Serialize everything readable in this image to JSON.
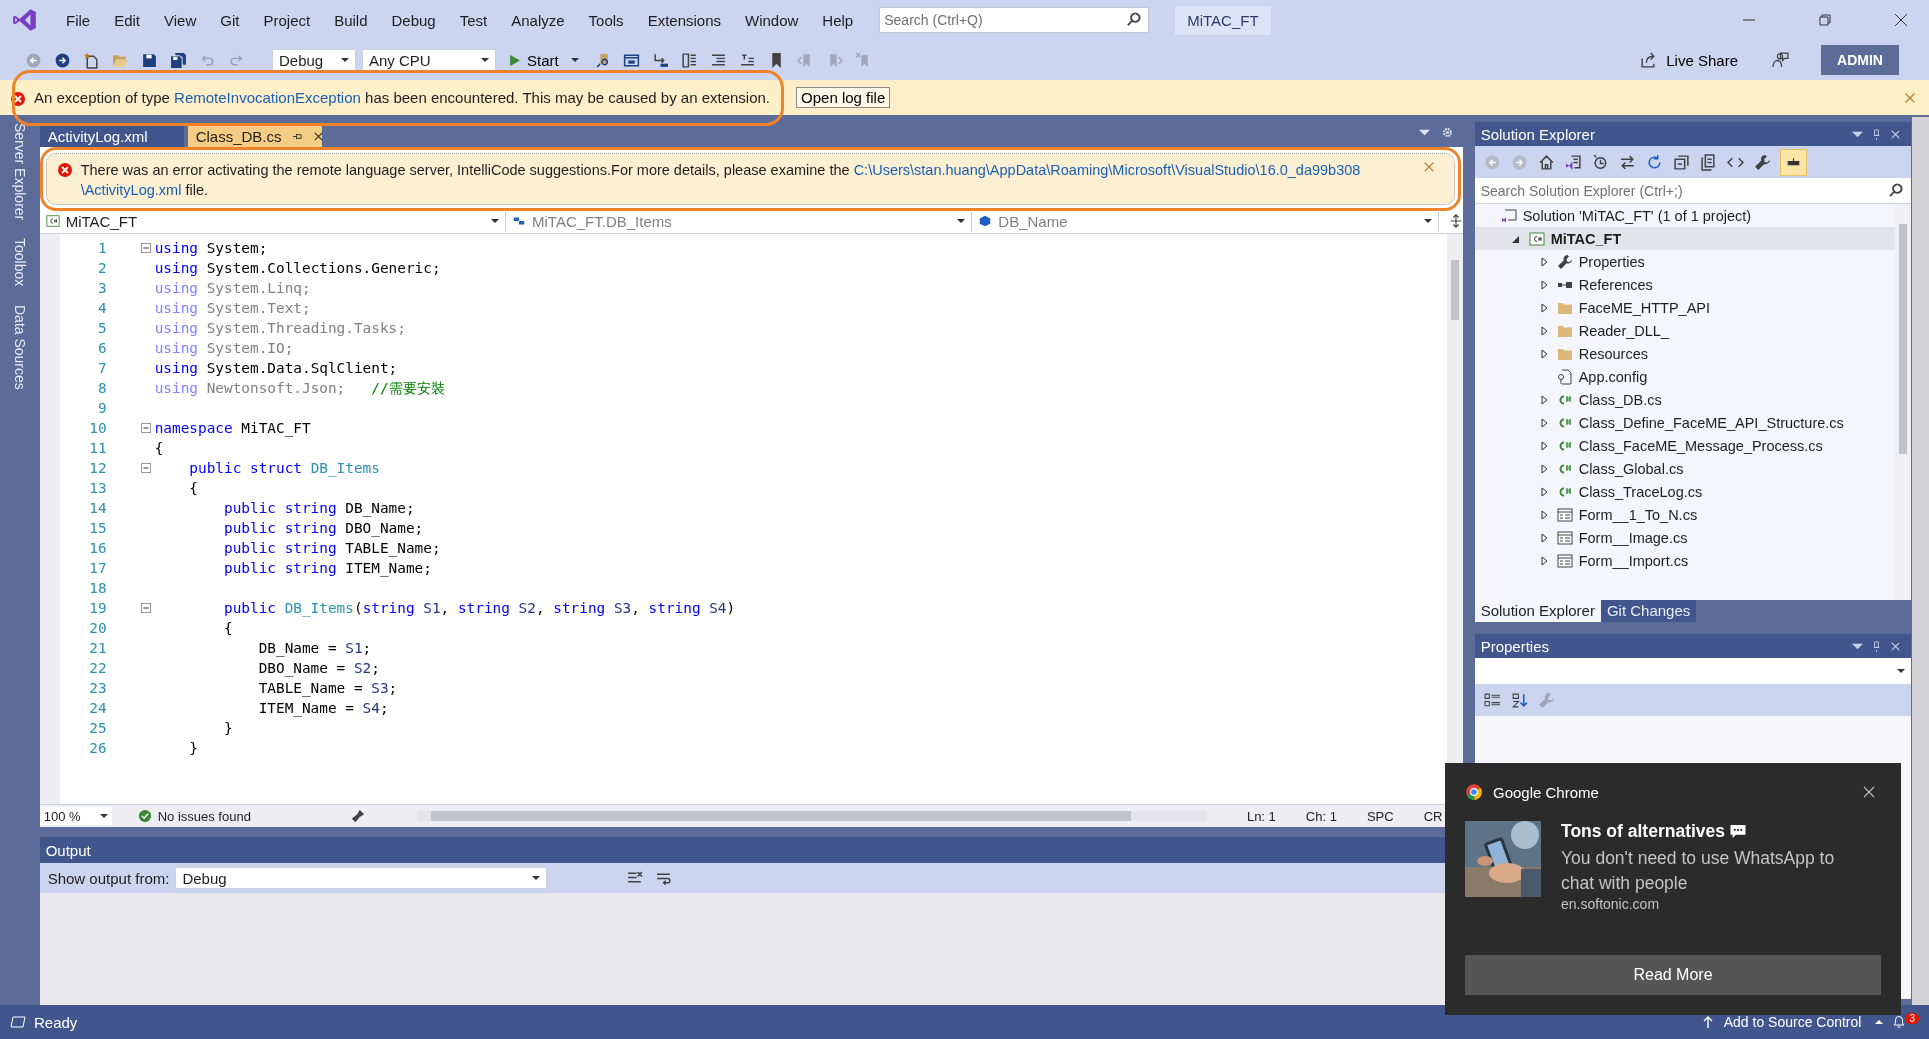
{
  "menu": [
    "File",
    "Edit",
    "View",
    "Git",
    "Project",
    "Build",
    "Debug",
    "Test",
    "Analyze",
    "Tools",
    "Extensions",
    "Window",
    "Help"
  ],
  "search": {
    "placeholder": "Search (Ctrl+Q)"
  },
  "solution_name": "MiTAC_FT",
  "toolbar": {
    "configuration": "Debug",
    "platform": "Any CPU",
    "start": "Start",
    "live_share": "Live Share",
    "account": "ADMIN"
  },
  "info_bar": {
    "before": "An exception of type ",
    "link": "RemoteInvocationException",
    "after": " has been encountered. This may be caused by an extension.",
    "button": "Open log file"
  },
  "side_tabs": [
    "Server Explorer",
    "Toolbox",
    "Data Sources"
  ],
  "editor": {
    "tabs": [
      {
        "label": "ActivityLog.xml",
        "selected": false
      },
      {
        "label": "Class_DB.cs",
        "selected": true
      }
    ],
    "error_bar": {
      "before": "There was an error activating the remote language server, IntelliCode suggestions.For more details, please examine the ",
      "link_lines": [
        "C:\\Users\\stan.huang\\AppData\\Roaming\\Microsoft\\VisualStudio\\16.0_da99b308",
        "\\ActivityLog.xml"
      ],
      "after": " file."
    },
    "nav": [
      "MiTAC_FT",
      "MiTAC_FT.DB_Items",
      "DB_Name"
    ],
    "lines": [
      {
        "number": "1",
        "foldable": true,
        "tokens": [
          {
            "kind": "kw",
            "text": "using"
          },
          {
            "kind": "plain",
            "text": " System;"
          }
        ]
      },
      {
        "number": "2",
        "foldable": false,
        "tokens": [
          {
            "kind": "kw",
            "text": "using"
          },
          {
            "kind": "plain",
            "text": " System.Collections.Generic;"
          }
        ]
      },
      {
        "number": "3",
        "foldable": false,
        "tokens": [
          {
            "kind": "kwdim",
            "text": "using"
          },
          {
            "kind": "dim",
            "text": " System.Linq;"
          }
        ]
      },
      {
        "number": "4",
        "foldable": false,
        "tokens": [
          {
            "kind": "kwdim",
            "text": "using"
          },
          {
            "kind": "dim",
            "text": " System.Text;"
          }
        ]
      },
      {
        "number": "5",
        "foldable": false,
        "tokens": [
          {
            "kind": "kwdim",
            "text": "using"
          },
          {
            "kind": "dim",
            "text": " System.Threading.Tasks;"
          }
        ]
      },
      {
        "number": "6",
        "foldable": false,
        "tokens": [
          {
            "kind": "kwdim",
            "text": "using"
          },
          {
            "kind": "dim",
            "text": " System.IO;"
          }
        ]
      },
      {
        "number": "7",
        "foldable": false,
        "tokens": [
          {
            "kind": "kw",
            "text": "using"
          },
          {
            "kind": "plain",
            "text": " System.Data.SqlClient;"
          }
        ]
      },
      {
        "number": "8",
        "foldable": false,
        "tokens": [
          {
            "kind": "kwdim",
            "text": "using"
          },
          {
            "kind": "dim",
            "text": " Newtonsoft.Json;"
          },
          {
            "kind": "comment",
            "text": "   //需要安裝"
          }
        ]
      },
      {
        "number": "9",
        "foldable": false
      },
      {
        "number": "10",
        "foldable": true,
        "tokens": [
          {
            "kind": "kw",
            "text": "namespace"
          },
          {
            "kind": "plain",
            "text": " MiTAC_FT"
          }
        ]
      },
      {
        "number": "11",
        "foldable": false,
        "tokens": [
          {
            "kind": "plain",
            "text": "{"
          }
        ]
      },
      {
        "number": "12",
        "foldable": true,
        "tokens": [
          {
            "kind": "kw",
            "text": "    public struct"
          },
          {
            "kind": "type",
            "text": " DB_Items"
          }
        ]
      },
      {
        "number": "13",
        "foldable": false,
        "tokens": [
          {
            "kind": "plain",
            "text": "    {"
          }
        ]
      },
      {
        "number": "14",
        "foldable": false,
        "tokens": [
          {
            "kind": "kw",
            "text": "        public string"
          },
          {
            "kind": "plain",
            "text": " DB_Name;"
          }
        ]
      },
      {
        "number": "15",
        "foldable": false,
        "tokens": [
          {
            "kind": "kw",
            "text": "        public string"
          },
          {
            "kind": "plain",
            "text": " DBO_Name;"
          }
        ]
      },
      {
        "number": "16",
        "foldable": false,
        "tokens": [
          {
            "kind": "kw",
            "text": "        public string"
          },
          {
            "kind": "plain",
            "text": " TABLE_Name;"
          }
        ]
      },
      {
        "number": "17",
        "foldable": false,
        "tokens": [
          {
            "kind": "kw",
            "text": "        public string"
          },
          {
            "kind": "plain",
            "text": " ITEM_Name;"
          }
        ]
      },
      {
        "number": "18",
        "foldable": false
      },
      {
        "number": "19",
        "foldable": true,
        "tokens": [
          {
            "kind": "kw",
            "text": "        public"
          },
          {
            "kind": "type",
            "text": " DB_Items"
          },
          {
            "kind": "plain",
            "text": "("
          },
          {
            "kind": "kw",
            "text": "string"
          },
          {
            "kind": "param",
            "text": " S1"
          },
          {
            "kind": "plain",
            "text": ", "
          },
          {
            "kind": "kw",
            "text": "string"
          },
          {
            "kind": "param",
            "text": " S2"
          },
          {
            "kind": "plain",
            "text": ", "
          },
          {
            "kind": "kw",
            "text": "string"
          },
          {
            "kind": "param",
            "text": " S3"
          },
          {
            "kind": "plain",
            "text": ", "
          },
          {
            "kind": "kw",
            "text": "string"
          },
          {
            "kind": "param",
            "text": " S4"
          },
          {
            "kind": "plain",
            "text": ")"
          }
        ]
      },
      {
        "number": "20",
        "foldable": false,
        "tokens": [
          {
            "kind": "plain",
            "text": "        {"
          }
        ]
      },
      {
        "number": "21",
        "foldable": false,
        "tokens": [
          {
            "kind": "plain",
            "text": "            DB_Name = "
          },
          {
            "kind": "param",
            "text": "S1"
          },
          {
            "kind": "plain",
            "text": ";"
          }
        ]
      },
      {
        "number": "22",
        "foldable": false,
        "tokens": [
          {
            "kind": "plain",
            "text": "            DBO_Name = "
          },
          {
            "kind": "param",
            "text": "S2"
          },
          {
            "kind": "plain",
            "text": ";"
          }
        ]
      },
      {
        "number": "23",
        "foldable": false,
        "tokens": [
          {
            "kind": "plain",
            "text": "            TABLE_Name = "
          },
          {
            "kind": "param",
            "text": "S3"
          },
          {
            "kind": "plain",
            "text": ";"
          }
        ]
      },
      {
        "number": "24",
        "foldable": false,
        "tokens": [
          {
            "kind": "plain",
            "text": "            ITEM_Name = "
          },
          {
            "kind": "param",
            "text": "S4"
          },
          {
            "kind": "plain",
            "text": ";"
          }
        ]
      },
      {
        "number": "25",
        "foldable": false,
        "tokens": [
          {
            "kind": "plain",
            "text": "        }"
          }
        ]
      },
      {
        "number": "26",
        "foldable": false,
        "tokens": [
          {
            "kind": "plain",
            "text": "    }"
          }
        ]
      }
    ],
    "status": {
      "zoom": "100 %",
      "issues": "No issues found",
      "line": "Ln: 1",
      "column": "Ch: 1",
      "whitespace": "SPC",
      "line_ending": "CR"
    }
  },
  "output": {
    "title": "Output",
    "label": "Show output from:",
    "source": "Debug"
  },
  "solution_explorer": {
    "title": "Solution Explorer",
    "search": {
      "placeholder": "Search Solution Explorer (Ctrl+;)"
    },
    "tree": [
      {
        "label": "Solution 'MiTAC_FT' (1 of 1 project)",
        "kind": "solution",
        "selected": false,
        "children": [
          {
            "label": "MiTAC_FT",
            "kind": "project",
            "expanded": true,
            "selected": true,
            "children": [
              {
                "label": "Properties",
                "kind": "properties",
                "expandable": true,
                "selected": false
              },
              {
                "label": "References",
                "kind": "references",
                "expandable": true,
                "selected": false
              },
              {
                "label": "FaceME_HTTP_API",
                "kind": "folder",
                "expandable": true,
                "selected": false
              },
              {
                "label": "Reader_DLL_",
                "kind": "folder",
                "expandable": true,
                "selected": false
              },
              {
                "label": "Resources",
                "kind": "folder",
                "expandable": true,
                "selected": false
              },
              {
                "label": "App.config",
                "kind": "config",
                "expandable": false,
                "selected": false
              },
              {
                "label": "Class_DB.cs",
                "kind": "csharp",
                "expandable": true,
                "selected": false
              },
              {
                "label": "Class_Define_FaceME_API_Structure.cs",
                "kind": "csharp",
                "expandable": true,
                "selected": false
              },
              {
                "label": "Class_FaceME_Message_Process.cs",
                "kind": "csharp",
                "expandable": true,
                "selected": false
              },
              {
                "label": "Class_Global.cs",
                "kind": "csharp",
                "expandable": true,
                "selected": false
              },
              {
                "label": "Class_TraceLog.cs",
                "kind": "csharp",
                "expandable": true,
                "selected": false
              },
              {
                "label": "Form__1_To_N.cs",
                "kind": "form",
                "expandable": true,
                "selected": false
              },
              {
                "label": "Form__Image.cs",
                "kind": "form",
                "expandable": true,
                "selected": false
              },
              {
                "label": "Form__Import.cs",
                "kind": "form",
                "expandable": true,
                "selected": false
              }
            ]
          }
        ]
      }
    ],
    "bottom_tabs": [
      {
        "label": "Solution Explorer",
        "selected": true
      },
      {
        "label": "Git Changes",
        "selected": false
      }
    ]
  },
  "properties": {
    "title": "Properties"
  },
  "notification": {
    "app": "Google Chrome",
    "title": "Tons of alternatives",
    "body": "You don't need to use WhatsApp to chat with people",
    "source": "en.softonic.com",
    "button": "Read More"
  },
  "status_bar": {
    "text": "Ready",
    "source_control": "Add to Source Control",
    "badge": "3"
  }
}
